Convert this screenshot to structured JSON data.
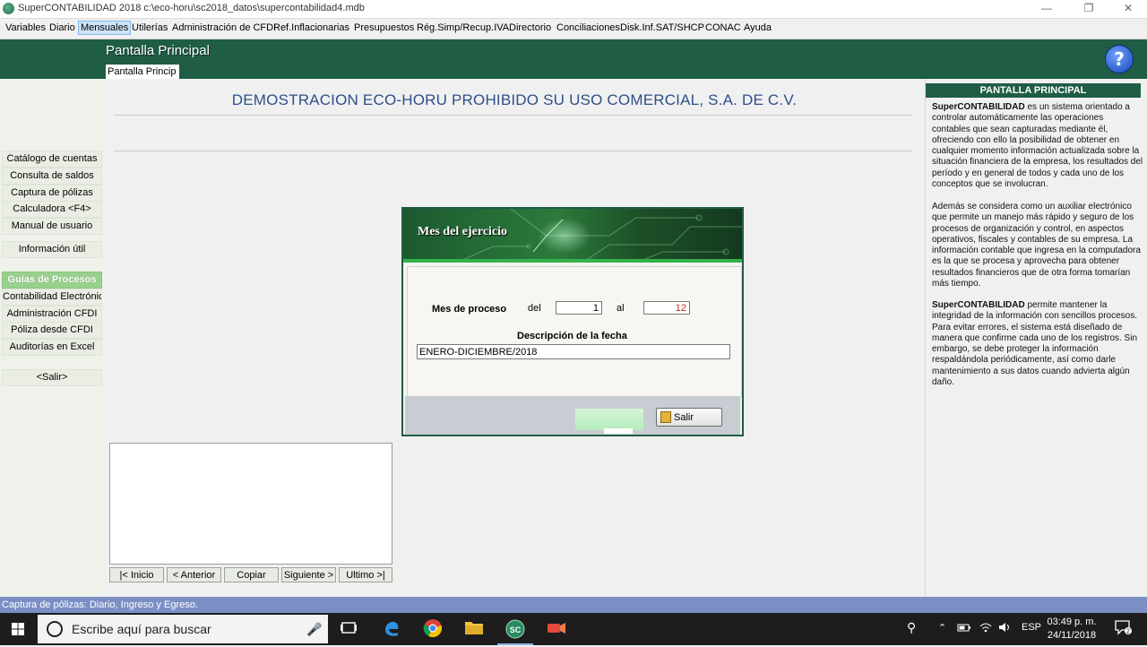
{
  "window": {
    "title": "SuperCONTABILIDAD 2018 c:\\eco-horu\\sc2018_datos\\supercontabilidad4.mdb",
    "minimize": "—",
    "restore": "❐",
    "close": "✕"
  },
  "menu": {
    "items": [
      "Variables",
      "Diario",
      "Mensuales",
      "Utilerías",
      "Administración de CFDI",
      "Ref.Inflacionarias",
      "Presupuestos",
      "Rég.Simp/Recup.IVA",
      "Directorio",
      "Conciliaciones",
      "Disk.Inf.SAT/SHCP",
      "CONAC",
      "Ayuda"
    ],
    "active": "Mensuales"
  },
  "header": {
    "title": "Pantalla Principal",
    "breadcrumb": "Pantalla Princip",
    "help": "?"
  },
  "sidebar": {
    "buttons": [
      "Catálogo de cuentas",
      "Consulta de saldos",
      "Captura de pólizas",
      "Calculadora  <F4>",
      "Manual de usuario",
      "Información útil"
    ],
    "section": "Guías de Procesos",
    "guides": [
      "Contabilidad Electrónica",
      "Administración CFDI",
      "Póliza desde CFDI",
      "Auditorías en Excel"
    ],
    "exit": "<Salir>"
  },
  "main": {
    "company": "DEMOSTRACION ECO-HORU PROHIBIDO SU USO COMERCIAL, S.A. DE C.V."
  },
  "dialog": {
    "title": "Mes del ejercicio",
    "period_label": "Mes de proceso",
    "from_label": "del",
    "from_value": "1",
    "to_label": "al",
    "to_value": "12",
    "desc_label": "Descripción de la fecha",
    "desc_value": "ENERO-DICIEMBRE/2018",
    "exit_button": "Salir"
  },
  "nav": {
    "first": "|< Inicio",
    "prev": "< Anterior",
    "copy": "Copiar",
    "next": "Siguiente >",
    "last": "Ultimo >|"
  },
  "right_panel": {
    "title": "PANTALLA PRINCIPAL",
    "p1_brand": "SuperCONTABILIDAD",
    "p1": " es un sistema orientado a controlar automáticamente las operaciones contables que sean capturadas mediante él, ofreciendo con ello la posibilidad de obtener en cualquier momento información actualizada sobre la situación financiera de la empresa, los resultados del período y en general de todos y cada uno de los conceptos que se involucran.",
    "p2": "Además se considera como un auxiliar electrónico que permite un manejo más rápido y seguro de los procesos de organización y control, en aspectos operativos, fiscales y contables de su empresa. La información contable que ingresa en la computadora es la que se procesa y aprovecha para obtener resultados financieros que de otra forma tomarían más tiempo.",
    "p3_brand": "SuperCONTABILIDAD",
    "p3": " permite mantener la integridad de la información con sencillos procesos. Para evitar errores, el sistema está diseñado de manera que confirme cada uno de los registros. Sin embargo, se debe proteger la información respaldándola periódicamente, así como darle mantenimiento a sus datos cuando advierta algún daño."
  },
  "status": {
    "text": "Captura de pólizas: Diario, Ingreso y Egreso."
  },
  "taskbar": {
    "search_placeholder": "Escribe aquí para buscar",
    "app_label": "SC",
    "lang": "ESP",
    "time": "03:49 p. m.",
    "date": "24/11/2018",
    "notif": "2"
  }
}
